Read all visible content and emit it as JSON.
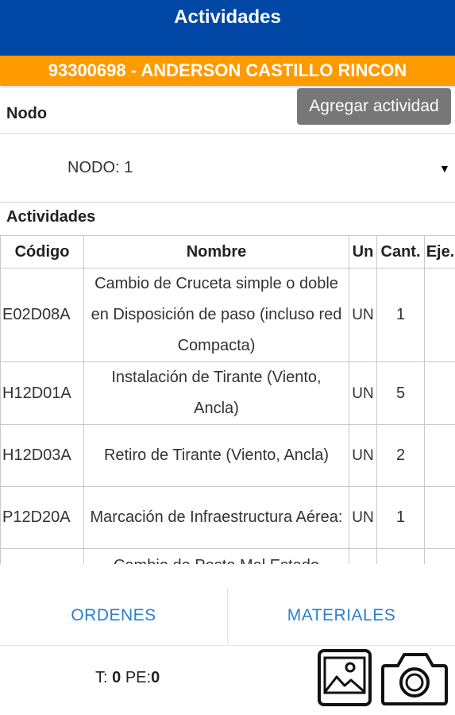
{
  "header": {
    "title": "Actividades"
  },
  "user_bar": {
    "text": "93300698 - ANDERSON CASTILLO RINCON"
  },
  "nodo": {
    "label": "Nodo",
    "add_button": "Agregar actividad",
    "selected": "NODO: 1"
  },
  "activities": {
    "label": "Actividades",
    "columns": [
      "Código",
      "Nombre",
      "Un",
      "Cant.",
      "Eje."
    ],
    "rows": [
      {
        "code": "E02D08A",
        "name": "Cambio de Cruceta simple o doble en Disposición de paso (incluso red Compacta)",
        "un": "UN",
        "cant": "1",
        "eje": ""
      },
      {
        "code": "H12D01A",
        "name": "Instalación de Tirante (Viento, Ancla)",
        "un": "UN",
        "cant": "5",
        "eje": ""
      },
      {
        "code": "H12D03A",
        "name": "Retiro de Tirante (Viento, Ancla)",
        "un": "UN",
        "cant": "2",
        "eje": ""
      },
      {
        "code": "P12D20A",
        "name": "Marcación de Infraestructura Aérea:",
        "un": "UN",
        "cant": "1",
        "eje": ""
      },
      {
        "code": "",
        "name": "Cambio de Poste Mal Estado",
        "un": "",
        "cant": "",
        "eje": ""
      }
    ]
  },
  "bottom_nav": {
    "ordenes": "ORDENES",
    "materiales": "MATERIALES"
  },
  "footer": {
    "t_label": "T:",
    "t_value": "0",
    "pe_label": "PE:",
    "pe_value": "0"
  },
  "icons": {
    "gallery": "image-gallery-icon",
    "camera": "camera-icon"
  },
  "colors": {
    "header": "#0047a6",
    "user_bar": "#ff9a00",
    "button": "#777777",
    "link": "#2a7fcf"
  }
}
